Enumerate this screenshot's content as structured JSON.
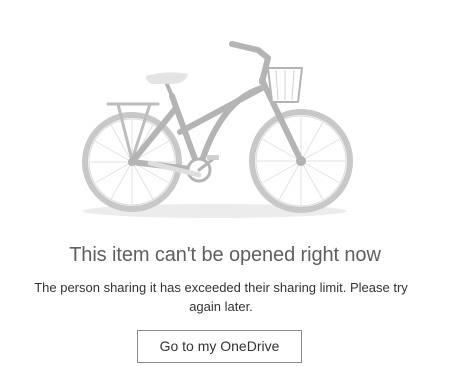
{
  "illustration": {
    "icon": "bicycle-illustration",
    "colors": {
      "frame": "#b4b4b4",
      "wheel": "#c8c8c8",
      "spokes": "#e2e2e2",
      "shadow": "#ececec",
      "saddle": "#e4e4e4"
    }
  },
  "error": {
    "title": "This item can't be opened right now",
    "message_line1": "The person sharing it has exceeded their sharing limit. Please try",
    "message_line2": "again later."
  },
  "actions": {
    "primary_label": "Go to my OneDrive"
  },
  "colors": {
    "background": "#ffffff",
    "title_text": "#5f5f5f",
    "body_text": "#333333",
    "button_border": "#8a8a8a"
  }
}
